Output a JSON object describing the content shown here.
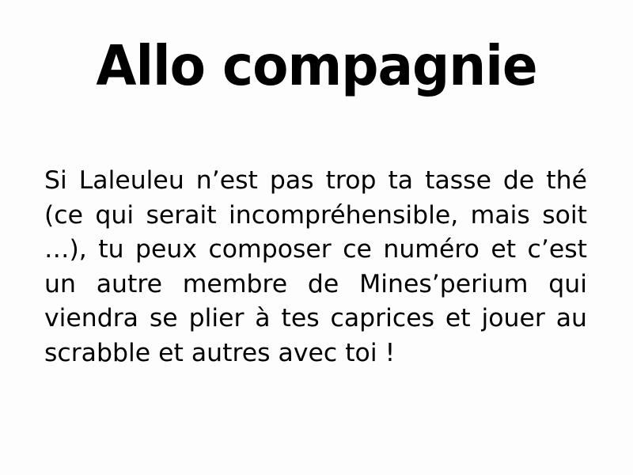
{
  "slide": {
    "title": "Allo compagnie",
    "body": "Si Laleuleu n’est pas trop ta tasse de thé (ce qui serait incompréhensible, mais soit …), tu peux composer ce numéro et c’est un autre membre de Mines’perium qui viendra se plier à tes caprices et jouer au scrabble et autres avec toi !"
  },
  "colors": {
    "background": "#fdfdfd",
    "text": "#000000"
  }
}
